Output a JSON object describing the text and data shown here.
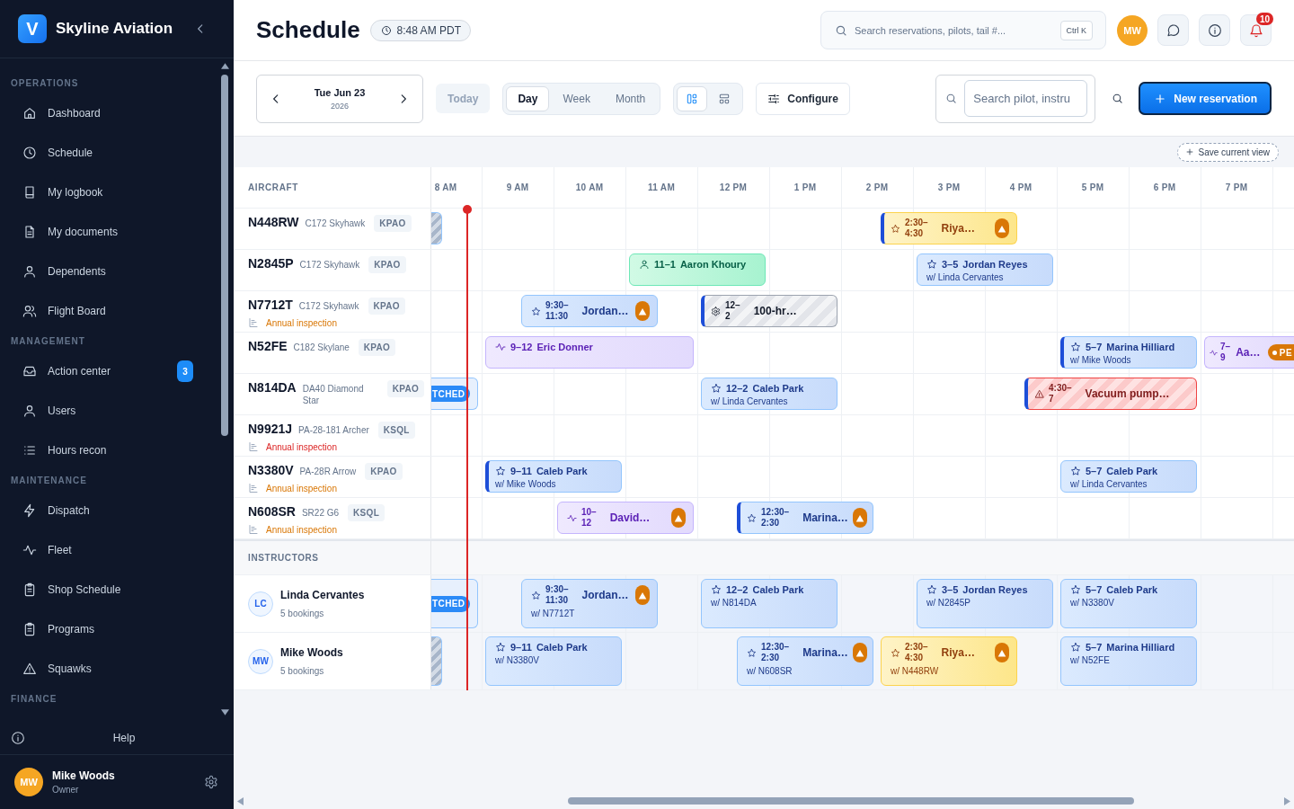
{
  "sidebar": {
    "logo_letter": "V",
    "app_name": "Skyline Aviation",
    "sections": [
      {
        "title": "OPERATIONS",
        "items": [
          {
            "label": "Dashboard"
          },
          {
            "label": "Schedule"
          },
          {
            "label": "My logbook"
          },
          {
            "label": "My documents"
          },
          {
            "label": "Dependents"
          },
          {
            "label": "Flight Board"
          }
        ]
      },
      {
        "title": "MANAGEMENT",
        "items": [
          {
            "label": "Action center",
            "badge": "3"
          },
          {
            "label": "Users"
          },
          {
            "label": "Hours recon"
          }
        ]
      },
      {
        "title": "MAINTENANCE",
        "items": [
          {
            "label": "Dispatch"
          },
          {
            "label": "Fleet"
          },
          {
            "label": "Shop Schedule"
          },
          {
            "label": "Programs"
          },
          {
            "label": "Squawks"
          }
        ]
      },
      {
        "title": "FINANCE"
      }
    ],
    "help": "Help",
    "user": {
      "initials": "MW",
      "name": "Mike Woods",
      "role": "Owner"
    }
  },
  "header": {
    "title": "Schedule",
    "clock": "8:48 AM PDT",
    "search": {
      "placeholder": "Search reservations, pilots, tail #...",
      "shortcut": "Ctrl K"
    },
    "avatar": "MW",
    "notifications": "10"
  },
  "toolbar": {
    "date": "Tue Jun 23",
    "year": "2026",
    "today": "Today",
    "views": [
      {
        "label": "Day",
        "selected": true
      },
      {
        "label": "Week",
        "selected": false
      },
      {
        "label": "Month",
        "selected": false
      }
    ],
    "layouts": [
      {
        "selected": true
      },
      {
        "selected": false
      }
    ],
    "configure": "Configure",
    "filter": {
      "placeholder": "Search pilot, instru"
    },
    "new_button": "New reservation",
    "save_view": "Save current view"
  },
  "schedule": {
    "hours": [
      "8 AM",
      "9 AM",
      "10 AM",
      "11 AM",
      "12 PM",
      "1 PM",
      "2 PM",
      "3 PM",
      "4 PM",
      "5 PM",
      "6 PM",
      "7 PM"
    ],
    "aircraft": {
      "header": "AIRCRAFT",
      "rows": [
        {
          "tail": "N448RW",
          "model": "C172 Skyhawk",
          "airport": "KPAO",
          "bookings": [
            {
              "kind": "blocked"
            },
            {
              "kind": "tentative",
              "time": "2:30–4:30",
              "title": "Riya…",
              "compact": true,
              "warning": true,
              "accent": true
            }
          ]
        },
        {
          "tail": "N2845P",
          "model": "C172 Skyhawk",
          "airport": "KPAO",
          "bookings": [
            {
              "kind": "rental",
              "time": "11–1",
              "title": "Aaron Khoury",
              "compact": false,
              "warning": false,
              "accent": false
            },
            {
              "kind": "lesson",
              "time": "3–5",
              "title": "Jordan Reyes",
              "subtitle": "w/ Linda Cervantes",
              "compact": false,
              "warning": false,
              "accent": false
            }
          ]
        },
        {
          "tail": "N7712T",
          "model": "C172 Skyhawk",
          "airport": "KPAO",
          "inspection": {
            "text": "Annual inspection",
            "color": "#d97706"
          },
          "bookings": [
            {
              "kind": "lesson",
              "time": "9:30–11:30",
              "title": "Jordan…",
              "compact": true,
              "warning": true,
              "accent": false
            },
            {
              "kind": "maintenance",
              "time": "12–2",
              "title": "100-hr…",
              "compact": true,
              "warning": false,
              "accent": true
            }
          ]
        },
        {
          "tail": "N52FE",
          "model": "C182 Skylane",
          "airport": "KPAO",
          "bookings": [
            {
              "kind": "flight",
              "time": "9–12",
              "title": "Eric Donner",
              "compact": false,
              "warning": false,
              "accent": false
            },
            {
              "kind": "lesson",
              "time": "5–7",
              "title": "Marina Hilliard",
              "subtitle": "w/ Mike Woods",
              "compact": false,
              "warning": false,
              "accent": true
            },
            {
              "kind": "flight",
              "time": "7–9",
              "title": "Aa…",
              "status": {
                "text": "PE",
                "color": "#d97706",
                "dot": true
              },
              "compact": true,
              "warning": false,
              "accent": false
            }
          ]
        },
        {
          "tail": "N814DA",
          "model": "DA40 Diamond Star",
          "airport": "KPAO",
          "bookings": [
            {
              "kind": "dispatched",
              "status": {
                "text": "TCHED",
                "color": "#2b8af7"
              }
            },
            {
              "kind": "lesson",
              "time": "12–2",
              "title": "Caleb Park",
              "subtitle": "w/ Linda Cervantes",
              "compact": false,
              "warning": false,
              "accent": false
            },
            {
              "kind": "squawk",
              "time": "4:30–7",
              "title": "Vacuum pump…",
              "compact": true,
              "warning": false,
              "accent": true
            }
          ]
        },
        {
          "tail": "N9921J",
          "model": "PA-28-181 Archer",
          "airport": "KSQL",
          "inspection": {
            "text": "Annual inspection",
            "color": "#dc2626"
          }
        },
        {
          "tail": "N3380V",
          "model": "PA-28R Arrow",
          "airport": "KPAO",
          "inspection": {
            "text": "Annual inspection",
            "color": "#d97706"
          },
          "bookings": [
            {
              "kind": "lesson",
              "time": "9–11",
              "title": "Caleb Park",
              "subtitle": "w/ Mike Woods",
              "compact": false,
              "warning": false,
              "accent": true
            },
            {
              "kind": "lesson",
              "time": "5–7",
              "title": "Caleb Park",
              "subtitle": "w/ Linda Cervantes",
              "compact": false,
              "warning": false,
              "accent": false
            }
          ]
        },
        {
          "tail": "N608SR",
          "model": "SR22 G6",
          "airport": "KSQL",
          "inspection": {
            "text": "Annual inspection",
            "color": "#d97706"
          },
          "bookings": [
            {
              "kind": "flight",
              "time": "10–12",
              "title": "David…",
              "compact": true,
              "warning": true,
              "accent": false
            },
            {
              "kind": "lesson",
              "time": "12:30–2:30",
              "title": "Marina…",
              "compact": true,
              "warning": true,
              "accent": true
            }
          ]
        }
      ]
    },
    "instructors": {
      "header": "INSTRUCTORS",
      "rows": [
        {
          "initials": "LC",
          "name": "Linda Cervantes",
          "count": "5 bookings",
          "bookings": [
            {
              "kind": "dispatched",
              "status": {
                "text": "TCHED",
                "color": "#2b8af7"
              }
            },
            {
              "kind": "lesson",
              "time": "9:30–11:30",
              "title": "Jordan…",
              "subtitle": "w/ N7712T",
              "compact": true,
              "warning": true,
              "accent": false
            },
            {
              "kind": "lesson",
              "time": "12–2",
              "title": "Caleb Park",
              "subtitle": "w/ N814DA",
              "compact": false,
              "warning": false,
              "accent": false
            },
            {
              "kind": "lesson",
              "time": "3–5",
              "title": "Jordan Reyes",
              "subtitle": "w/ N2845P",
              "compact": false,
              "warning": false,
              "accent": false
            },
            {
              "kind": "lesson",
              "time": "5–7",
              "title": "Caleb Park",
              "subtitle": "w/ N3380V",
              "compact": false,
              "warning": false,
              "accent": false
            }
          ]
        },
        {
          "initials": "MW",
          "name": "Mike Woods",
          "count": "5 bookings",
          "bookings": [
            {
              "kind": "blocked"
            },
            {
              "kind": "lesson",
              "time": "9–11",
              "title": "Caleb Park",
              "subtitle": "w/ N3380V",
              "compact": false,
              "warning": false,
              "accent": false
            },
            {
              "kind": "lesson",
              "time": "12:30–2:30",
              "title": "Marina…",
              "subtitle": "w/ N608SR",
              "compact": true,
              "warning": true,
              "accent": false
            },
            {
              "kind": "tentative",
              "time": "2:30–4:30",
              "title": "Riya…",
              "subtitle": "w/ N448RW",
              "compact": true,
              "warning": true,
              "accent": false
            },
            {
              "kind": "lesson",
              "time": "5–7",
              "title": "Marina Hilliard",
              "subtitle": "w/ N52FE",
              "compact": false,
              "warning": false,
              "accent": false
            }
          ]
        }
      ]
    }
  }
}
